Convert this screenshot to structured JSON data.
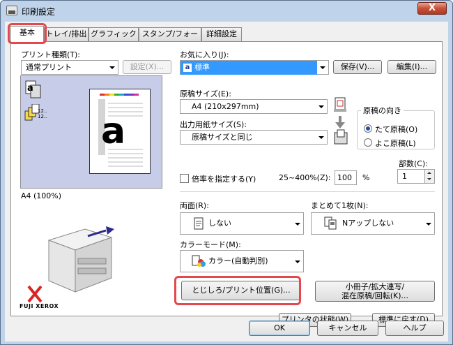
{
  "window": {
    "title": "印刷設定",
    "close_label": "X"
  },
  "tabs": [
    "基本",
    "トレイ/排出",
    "グラフィックス",
    "スタンプ/フォーム",
    "詳細設定"
  ],
  "printer_type": {
    "label": "プリント種類(T):",
    "value": "通常プリント",
    "settings_button": "設定(X)..."
  },
  "favorites": {
    "label": "お気に入り(J):",
    "value": "標準",
    "save_button": "保存(V)...",
    "edit_button": "編集(I)..."
  },
  "preview": {
    "caption": "A4 (100%)",
    "sheet_letter": "a",
    "badge_letter": "a",
    "copies_icon_text": "12.."
  },
  "original_size": {
    "label": "原稿サイズ(E):",
    "value": "A4 (210x297mm)"
  },
  "output_size": {
    "label": "出力用紙サイズ(S):",
    "value": "原稿サイズと同じ"
  },
  "scale": {
    "label": "倍率を指定する(Y)",
    "range": "25~400%(Z):",
    "value": "100",
    "unit": "%"
  },
  "orientation": {
    "label": "原稿の向き",
    "portrait": "たて原稿(O)",
    "landscape": "よこ原稿(L)"
  },
  "copies": {
    "label": "部数(C):",
    "value": "1"
  },
  "duplex": {
    "label": "両面(R):",
    "value": "しない"
  },
  "nup": {
    "label": "まとめて1枚(N):",
    "value": "Nアップしない"
  },
  "color_mode": {
    "label": "カラーモード(M):",
    "value": "カラー(自動判別)"
  },
  "binding_button": "とじしろ/プリント位置(G)...",
  "booklet_button": {
    "line1": "小冊子/拡大連写/",
    "line2": "混在原稿/回転(K)..."
  },
  "status_button": "プリンタの状態(W)",
  "defaults_button": "標準に戻す(D)",
  "brand": {
    "mark": "X",
    "name": "FUJI XEROX"
  },
  "footer": {
    "ok": "OK",
    "cancel": "キャンセル",
    "help": "ヘルプ"
  },
  "colors": {
    "highlight": "#e4474d",
    "selection": "#3399ff",
    "preview_bg": "#c7cde8"
  }
}
